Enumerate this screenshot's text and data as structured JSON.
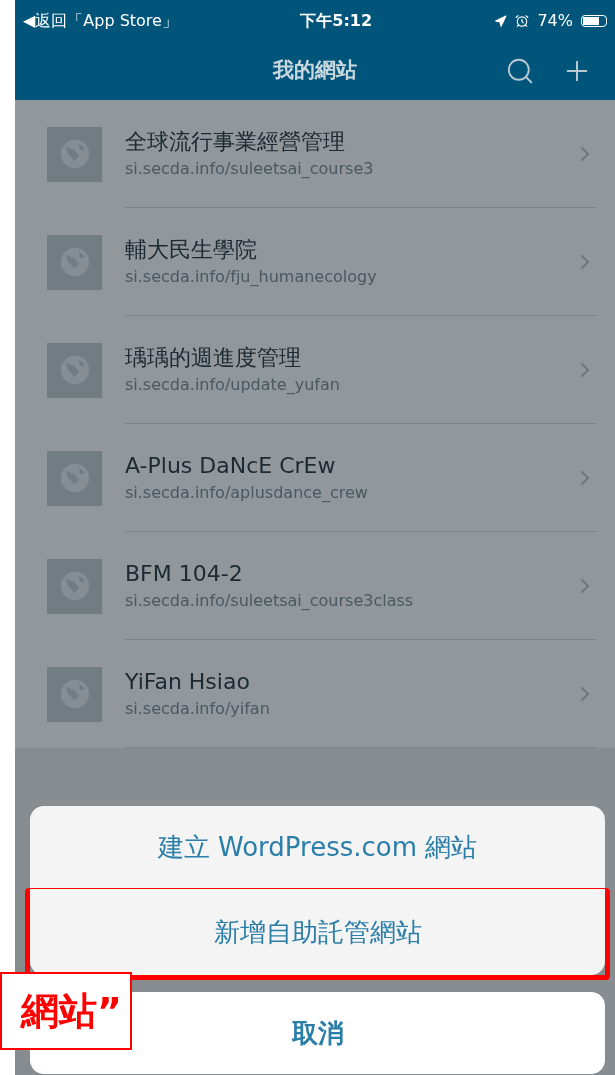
{
  "status_bar": {
    "back": "◀返回「App Store」",
    "time": "下午5:12",
    "battery": "74%"
  },
  "nav": {
    "title": "我的網站"
  },
  "sites": [
    {
      "name": "全球流行事業經營管理",
      "url": "si.secda.info/suleetsai_course3"
    },
    {
      "name": "輔大民生學院",
      "url": "si.secda.info/fju_humanecology"
    },
    {
      "name": "瑀瑀的週進度管理",
      "url": "si.secda.info/update_yufan"
    },
    {
      "name": "A-Plus DaNcE CrEw",
      "url": "si.secda.info/aplusdance_crew"
    },
    {
      "name": "BFM 104-2",
      "url": "si.secda.info/suleetsai_course3class"
    },
    {
      "name": "YiFan Hsiao",
      "url": "si.secda.info/yifan"
    }
  ],
  "action_sheet": {
    "options": [
      {
        "label": "建立 WordPress.com 網站",
        "highlighted": false
      },
      {
        "label": "新增自助託管網站",
        "highlighted": true
      }
    ],
    "cancel": "取消"
  },
  "callout": {
    "text": "網站”"
  }
}
